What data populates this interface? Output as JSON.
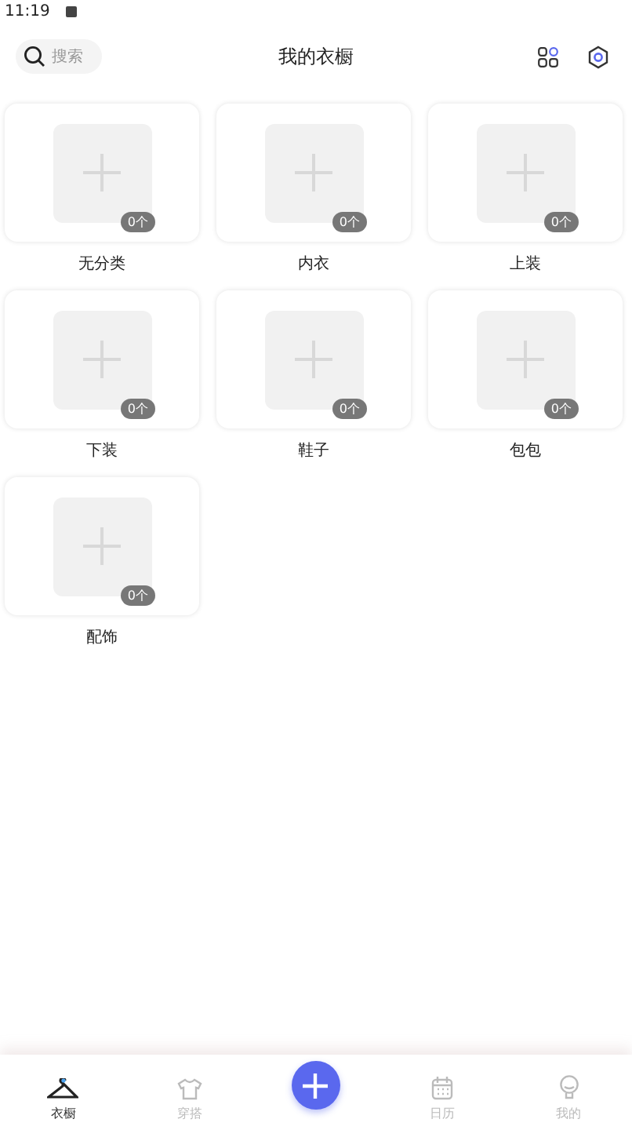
{
  "status_bar": {
    "time": "11:19"
  },
  "header": {
    "search": {
      "placeholder": "搜索"
    },
    "title": "我的衣橱"
  },
  "categories": [
    {
      "name": "无分类",
      "count": "0个"
    },
    {
      "name": "内衣",
      "count": "0个"
    },
    {
      "name": "上装",
      "count": "0个"
    },
    {
      "name": "下装",
      "count": "0个"
    },
    {
      "name": "鞋子",
      "count": "0个"
    },
    {
      "name": "包包",
      "count": "0个"
    },
    {
      "name": "配饰",
      "count": "0个"
    }
  ],
  "bottom_nav": [
    {
      "kind": "hanger",
      "label": "衣橱",
      "selected": true
    },
    {
      "kind": "shirt",
      "label": "穿搭",
      "selected": false
    },
    {
      "kind": "add"
    },
    {
      "kind": "calendar",
      "label": "日历",
      "selected": false
    },
    {
      "kind": "bulb",
      "label": "我的",
      "selected": false
    }
  ]
}
